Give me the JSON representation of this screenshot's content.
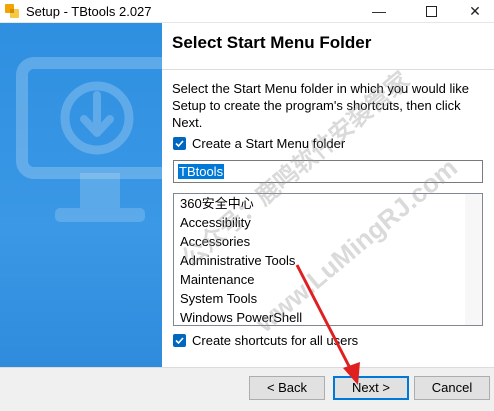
{
  "window": {
    "title": "Setup - TBtools 2.027",
    "minimize": "—",
    "close": "✕"
  },
  "page": {
    "heading": "Select Start Menu Folder",
    "description": "Select the Start Menu folder in which you would like Setup to create the program's shortcuts, then click Next."
  },
  "create_folder_checkbox": {
    "label": "Create a Start Menu folder",
    "checked": true
  },
  "folder_name": "TBtools",
  "folders": [
    "360安全中心",
    "Accessibility",
    "Accessories",
    "Administrative Tools",
    "Maintenance",
    "System Tools",
    "Windows PowerShell"
  ],
  "all_users_checkbox": {
    "label": "Create shortcuts for all users",
    "checked": true
  },
  "buttons": {
    "back": "< Back",
    "next": "Next >",
    "cancel": "Cancel"
  },
  "watermarks": [
    "公众号：鹿鸣软件安装管家",
    "www.LuMingRJ.com"
  ],
  "colors": {
    "accent": "#0078d7",
    "banner": "#3a98e6",
    "arrow": "#e02020"
  }
}
